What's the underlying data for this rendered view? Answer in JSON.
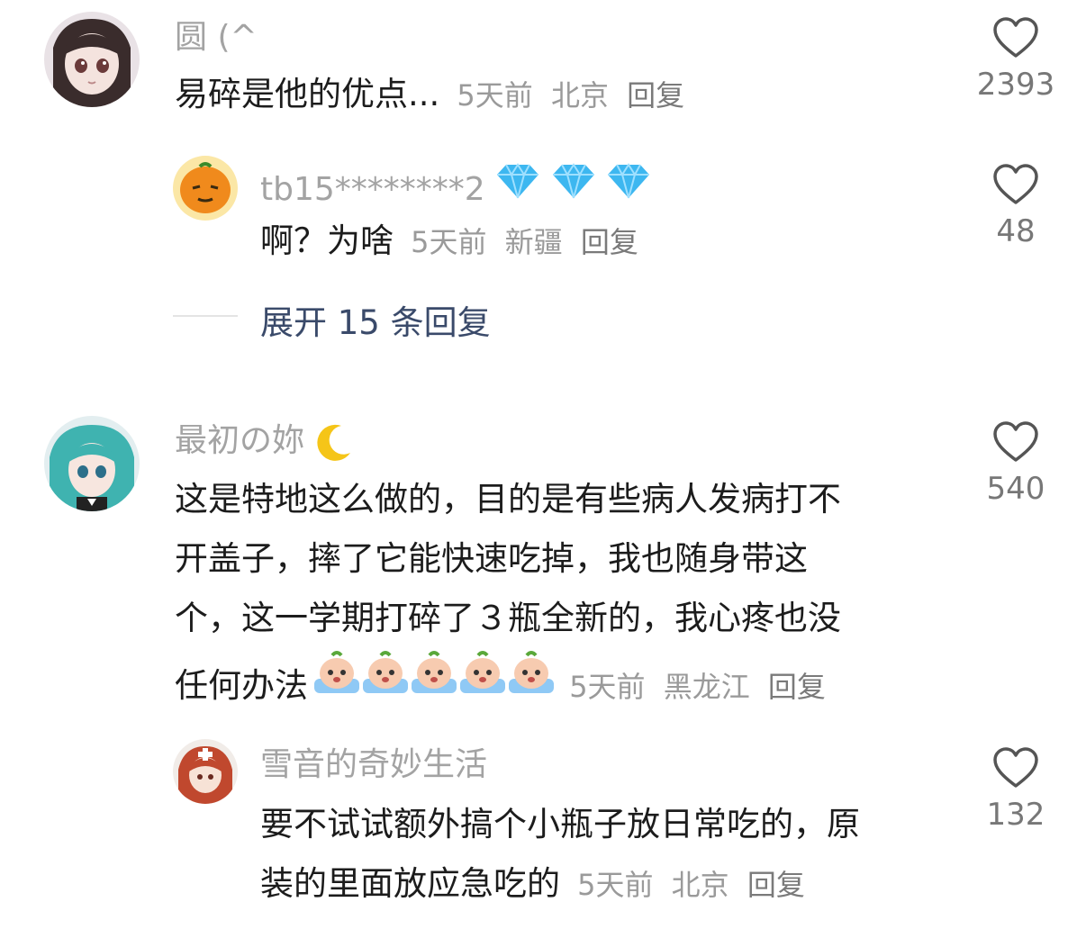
{
  "comments": [
    {
      "user": "圆 (^",
      "text": "易碎是他的优点...",
      "time": "5天前",
      "location": "北京",
      "reply_label": "回复",
      "likes": "2393",
      "replies": [
        {
          "user": "tb15********2",
          "badge_icons": [
            "diamond-icon",
            "diamond-icon",
            "diamond-icon"
          ],
          "text": "啊？为啥",
          "time": "5天前",
          "location": "新疆",
          "reply_label": "回复",
          "likes": "48"
        }
      ],
      "expand_label": "展开 15 条回复"
    },
    {
      "user": "最初の妳",
      "user_icon": "crescent-moon-icon",
      "text_lines": [
        "这是特地这么做的，目的是有些病人发病打不",
        "开盖子，摔了它能快速吃掉，我也随身带这",
        "个，这一学期打碎了３瓶全新的，我心疼也没",
        "任何办法"
      ],
      "emoji_icons": [
        "crying-face-icon",
        "crying-face-icon",
        "crying-face-icon",
        "crying-face-icon",
        "crying-face-icon"
      ],
      "time": "5天前",
      "location": "黑龙江",
      "reply_label": "回复",
      "likes": "540",
      "replies": [
        {
          "user": "雪音的奇妙生活",
          "text_lines": [
            "要不试试额外搞个小瓶子放日常吃的，原",
            "装的里面放应急吃的"
          ],
          "time": "5天前",
          "location": "北京",
          "reply_label": "回复",
          "likes": "132"
        }
      ]
    }
  ],
  "colors": {
    "name": "#a3a3a3",
    "text": "#1c1c1c",
    "meta": "#9a9a9a",
    "expand": "#3a4a6a",
    "diamond": "#3db7f0"
  }
}
